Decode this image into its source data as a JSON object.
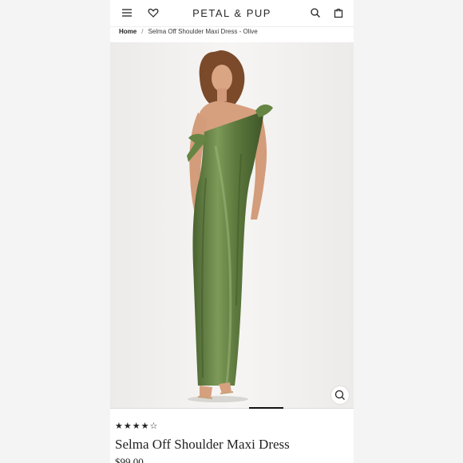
{
  "header": {
    "logo": "PETAL & PUP",
    "icons": [
      "menu-icon",
      "heart-icon",
      "search-icon",
      "bag-icon"
    ]
  },
  "breadcrumb": {
    "home": "Home",
    "separator": "/",
    "current": "Selma Off Shoulder Maxi Dress - Olive"
  },
  "gallery": {
    "image_subject": "model-in-olive-satin-maxi-dress",
    "zoom_icon": "zoom-search-icon",
    "progress_fraction": 0.15
  },
  "product": {
    "rating_stars": "★★★★☆",
    "rating_value": 4,
    "name": "Selma Off Shoulder Maxi Dress",
    "price": "$99.00"
  },
  "colors": {
    "dress_olive": "#5e7a3e",
    "background": "#f0efed"
  }
}
